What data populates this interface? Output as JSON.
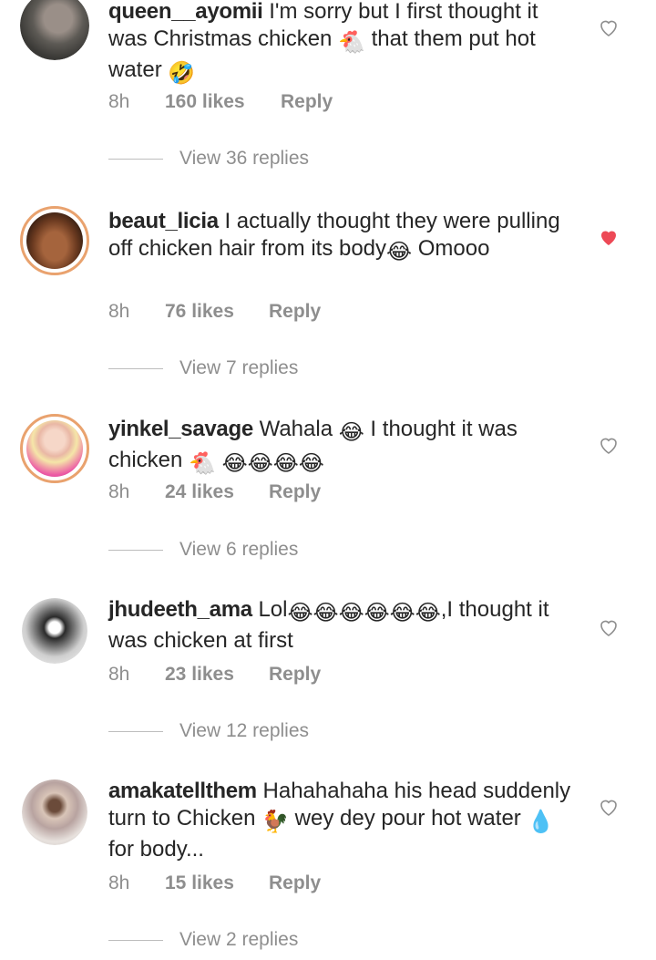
{
  "comments": [
    {
      "username": "queen__ayomii",
      "text_parts": [
        "I'm sorry but I first thought it was Christmas chicken ",
        " that them put hot water "
      ],
      "time": "8h",
      "likes": "160 likes",
      "reply": "Reply",
      "view_replies": "View 36 replies",
      "liked": false
    },
    {
      "username": "beaut_licia",
      "text_parts": [
        "I actually thought they were pulling off chicken hair from its body",
        " Omooo"
      ],
      "time": "8h",
      "likes": "76 likes",
      "reply": "Reply",
      "view_replies": "View 7 replies",
      "liked": true
    },
    {
      "username": "yinkel_savage",
      "text_parts": [
        "Wahala ",
        " I thought it was chicken "
      ],
      "time": "8h",
      "likes": "24 likes",
      "reply": "Reply",
      "view_replies": "View 6 replies",
      "liked": false
    },
    {
      "username": "jhudeeth_ama",
      "text_parts": [
        "Lol",
        ",I thought it was chicken at first"
      ],
      "time": "8h",
      "likes": "23 likes",
      "reply": "Reply",
      "view_replies": "View 12 replies",
      "liked": false
    },
    {
      "username": "amakatellthem",
      "text_parts": [
        "Hahahahaha his head suddenly turn to Chicken ",
        " wey dey pour hot water ",
        " for body..."
      ],
      "time": "8h",
      "likes": "15 likes",
      "reply": "Reply",
      "view_replies": "View 2 replies",
      "liked": false
    }
  ],
  "colors": {
    "text": "#262626",
    "muted": "#8e8e8e",
    "liked_heart": "#ed4956",
    "story_ring": "#e9a26e"
  },
  "icons": [
    "heart-icon",
    "heart-filled-icon",
    "chicken-emoji",
    "rolling-laugh-emoji",
    "tears-of-joy-emoji",
    "rooster-emoji",
    "droplet-emoji"
  ]
}
